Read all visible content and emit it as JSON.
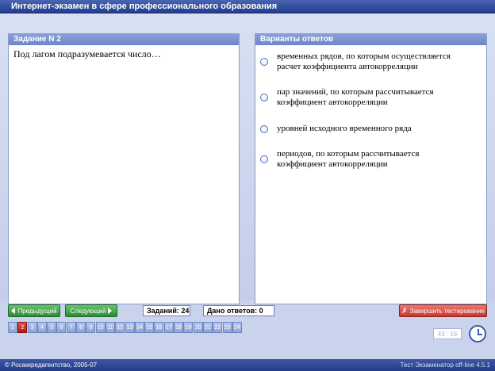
{
  "window": {
    "title": "Интернет-экзамен в сфере профессионального образования"
  },
  "question_panel": {
    "header": "Задание N 2",
    "text": "Под лагом подразумевается число…"
  },
  "answers_panel": {
    "header": "Варианты ответов",
    "options": [
      {
        "line1": "временных рядов, по которым осуществляется",
        "line2": "расчет коэффициента автокорреляции"
      },
      {
        "line1": "пар значений, по которым рассчитывается",
        "line2": "коэффициент автокорреляции"
      },
      {
        "line1": "уровней исходного временного ряда",
        "line2": ""
      },
      {
        "line1": "периодов, по которым рассчитывается",
        "line2": "коэффициент автокорреляции"
      }
    ]
  },
  "toolbar": {
    "prev_label": "Предыдущий",
    "next_label": "Следующий",
    "tasks_label": "Заданий: 24",
    "answered_label": "Дано ответов: 0",
    "finish_label": "Завершить тестирование"
  },
  "pager": {
    "pages": [
      "1",
      "2",
      "3",
      "4",
      "5",
      "6",
      "7",
      "8",
      "9",
      "10",
      "11",
      "12",
      "13",
      "14",
      "15",
      "16",
      "17",
      "18",
      "19",
      "20",
      "21",
      "22",
      "23",
      "24"
    ],
    "current": "2"
  },
  "timer": {
    "value": "43 : 16"
  },
  "status": {
    "left": "© Росаккредагентство, 2005-07",
    "right": "Тест Экзаменатор off-line 4.5.1"
  },
  "colors": {
    "title_bar": "#223d8f",
    "panel_header": "#6d86c7",
    "nav_button": "#2e8a36",
    "finish_button": "#c23a30",
    "current_page": "#b0201a"
  }
}
